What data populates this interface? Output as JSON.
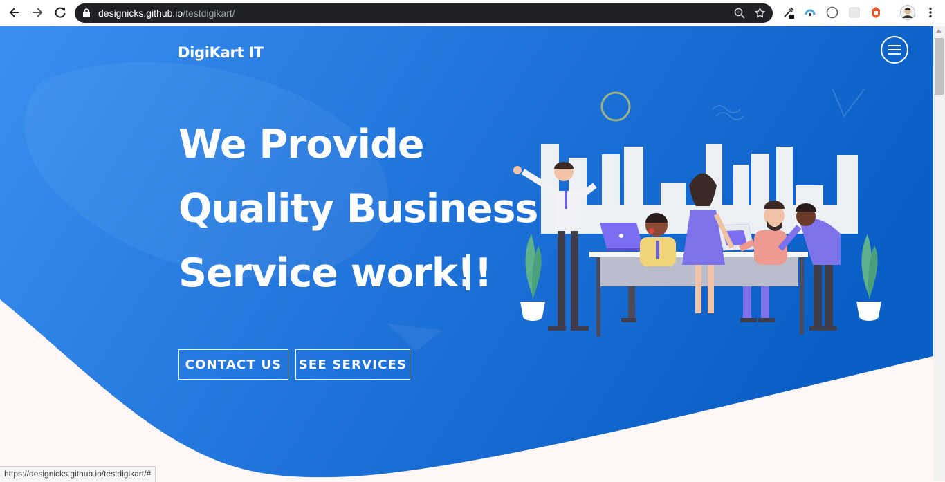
{
  "browser": {
    "url_host": "designicks.github.io",
    "url_path": "/testdigikart/",
    "icons": [
      "back-arrow-icon",
      "forward-arrow-icon",
      "reload-icon",
      "lock-icon",
      "zoom-icon",
      "bookmark-star-icon",
      "eyedropper-extension-icon",
      "extension-icon",
      "dark-mode-extension-icon",
      "extension-icon",
      "extension-icon",
      "profile-avatar-icon",
      "more-menu-icon"
    ]
  },
  "site": {
    "brand": "DigiKart IT",
    "menu_icon": "hamburger-menu-icon"
  },
  "hero": {
    "line1": "We Provide",
    "line2": "Quality Business",
    "line3": "Service work!!",
    "cta_primary": "CONTACT US",
    "cta_secondary": "SEE SERVICES"
  },
  "status_bar": {
    "text": "https://designicks.github.io/testdigikart/#"
  },
  "colors": {
    "hero_gradient_start": "#3a8ff0",
    "hero_gradient_end": "#0a5fc6",
    "page_background": "#fff7f6"
  }
}
